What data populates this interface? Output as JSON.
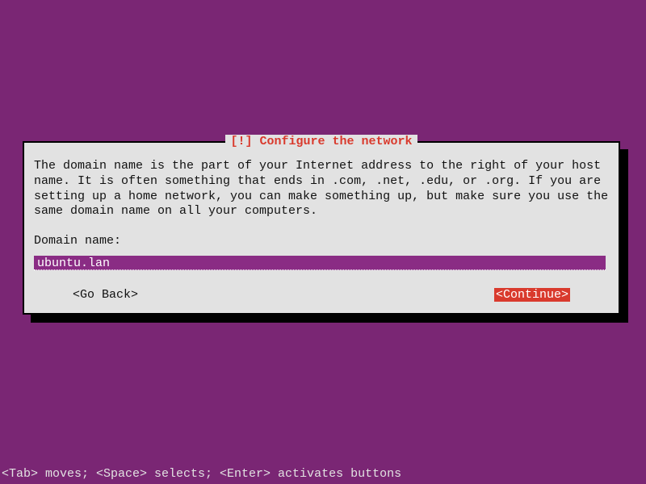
{
  "dialog": {
    "title": "[!] Configure the network",
    "description": "The domain name is the part of your Internet address to the right of your host name.  It is often something that ends in .com, .net, .edu, or .org.  If you are setting up a home network, you can make something up, but make sure you use the same domain name on all your computers.",
    "field_label": "Domain name:",
    "field_value": "ubuntu.lan",
    "go_back_label": "<Go Back>",
    "continue_label": "<Continue>"
  },
  "footer": {
    "hint": "<Tab> moves; <Space> selects; <Enter> activates buttons"
  },
  "colors": {
    "background": "#7a2674",
    "dialog_bg": "#e2e2e2",
    "accent": "#d93a2d",
    "input_bg": "#8a2c84"
  }
}
